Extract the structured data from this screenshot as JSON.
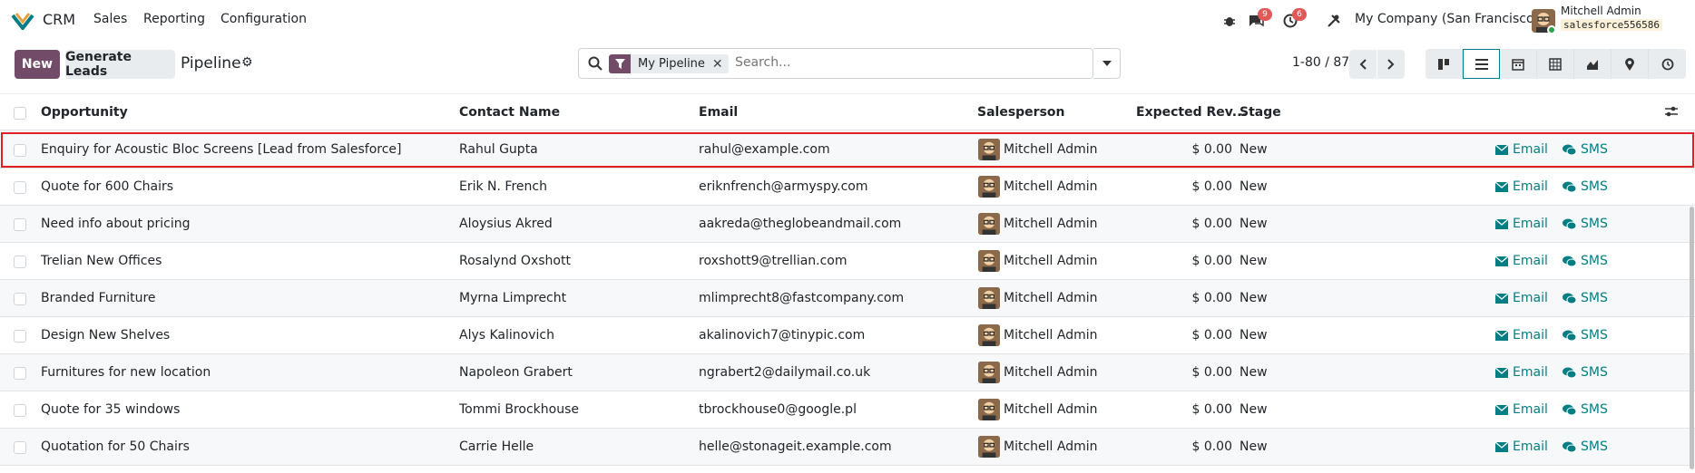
{
  "nav": {
    "app_name": "CRM",
    "menu": [
      "Sales",
      "Reporting",
      "Configuration"
    ],
    "messages_badge": "9",
    "activities_badge": "6",
    "company": "My Company (San Francisco)",
    "user_name": "Mitchell Admin",
    "db_name": "salesforce556586",
    "icons": [
      "bug-icon",
      "chat-icon",
      "clock-icon",
      "tools-icon"
    ]
  },
  "control": {
    "new_label": "New",
    "generate_label": "Generate Leads",
    "title": "Pipeline",
    "facet_label": "My Pipeline",
    "search_placeholder": "Search...",
    "pager": "1-80 / 87",
    "views": [
      "kanban",
      "list",
      "calendar",
      "pivot",
      "graph",
      "map",
      "activity"
    ],
    "active_view": "list"
  },
  "table": {
    "columns": [
      "Opportunity",
      "Contact Name",
      "Email",
      "Salesperson",
      "Expected Rev...",
      "Stage"
    ],
    "action_email": "Email",
    "action_sms": "SMS",
    "rows": [
      {
        "opportunity": "Enquiry for Acoustic Bloc Screens [Lead from Salesforce]",
        "contact": "Rahul Gupta",
        "email": "rahul@example.com",
        "salesperson": "Mitchell Admin",
        "revenue": "$ 0.00",
        "stage": "New"
      },
      {
        "opportunity": "Quote for 600 Chairs",
        "contact": "Erik N. French",
        "email": "eriknfrench@armyspy.com",
        "salesperson": "Mitchell Admin",
        "revenue": "$ 0.00",
        "stage": "New"
      },
      {
        "opportunity": "Need info about pricing",
        "contact": "Aloysius Akred",
        "email": "aakreda@theglobeandmail.com",
        "salesperson": "Mitchell Admin",
        "revenue": "$ 0.00",
        "stage": "New"
      },
      {
        "opportunity": "Trelian New Offices",
        "contact": "Rosalynd Oxshott",
        "email": "roxshott9@trellian.com",
        "salesperson": "Mitchell Admin",
        "revenue": "$ 0.00",
        "stage": "New"
      },
      {
        "opportunity": "Branded Furniture",
        "contact": "Myrna Limprecht",
        "email": "mlimprecht8@fastcompany.com",
        "salesperson": "Mitchell Admin",
        "revenue": "$ 0.00",
        "stage": "New"
      },
      {
        "opportunity": "Design New Shelves",
        "contact": "Alys Kalinovich",
        "email": "akalinovich7@tinypic.com",
        "salesperson": "Mitchell Admin",
        "revenue": "$ 0.00",
        "stage": "New"
      },
      {
        "opportunity": "Furnitures for new location",
        "contact": "Napoleon Grabert",
        "email": "ngrabert2@dailymail.co.uk",
        "salesperson": "Mitchell Admin",
        "revenue": "$ 0.00",
        "stage": "New"
      },
      {
        "opportunity": "Quote for 35 windows",
        "contact": "Tommi Brockhouse",
        "email": "tbrockhouse0@google.pl",
        "salesperson": "Mitchell Admin",
        "revenue": "$ 0.00",
        "stage": "New"
      },
      {
        "opportunity": "Quotation for 50 Chairs",
        "contact": "Carrie Helle",
        "email": "helle@stonageit.example.com",
        "salesperson": "Mitchell Admin",
        "revenue": "$ 0.00",
        "stage": "New"
      }
    ]
  },
  "colors": {
    "brand": "#714b67",
    "accent": "#017e84",
    "badge": "#e05a5a",
    "highlight": "#e02020"
  }
}
